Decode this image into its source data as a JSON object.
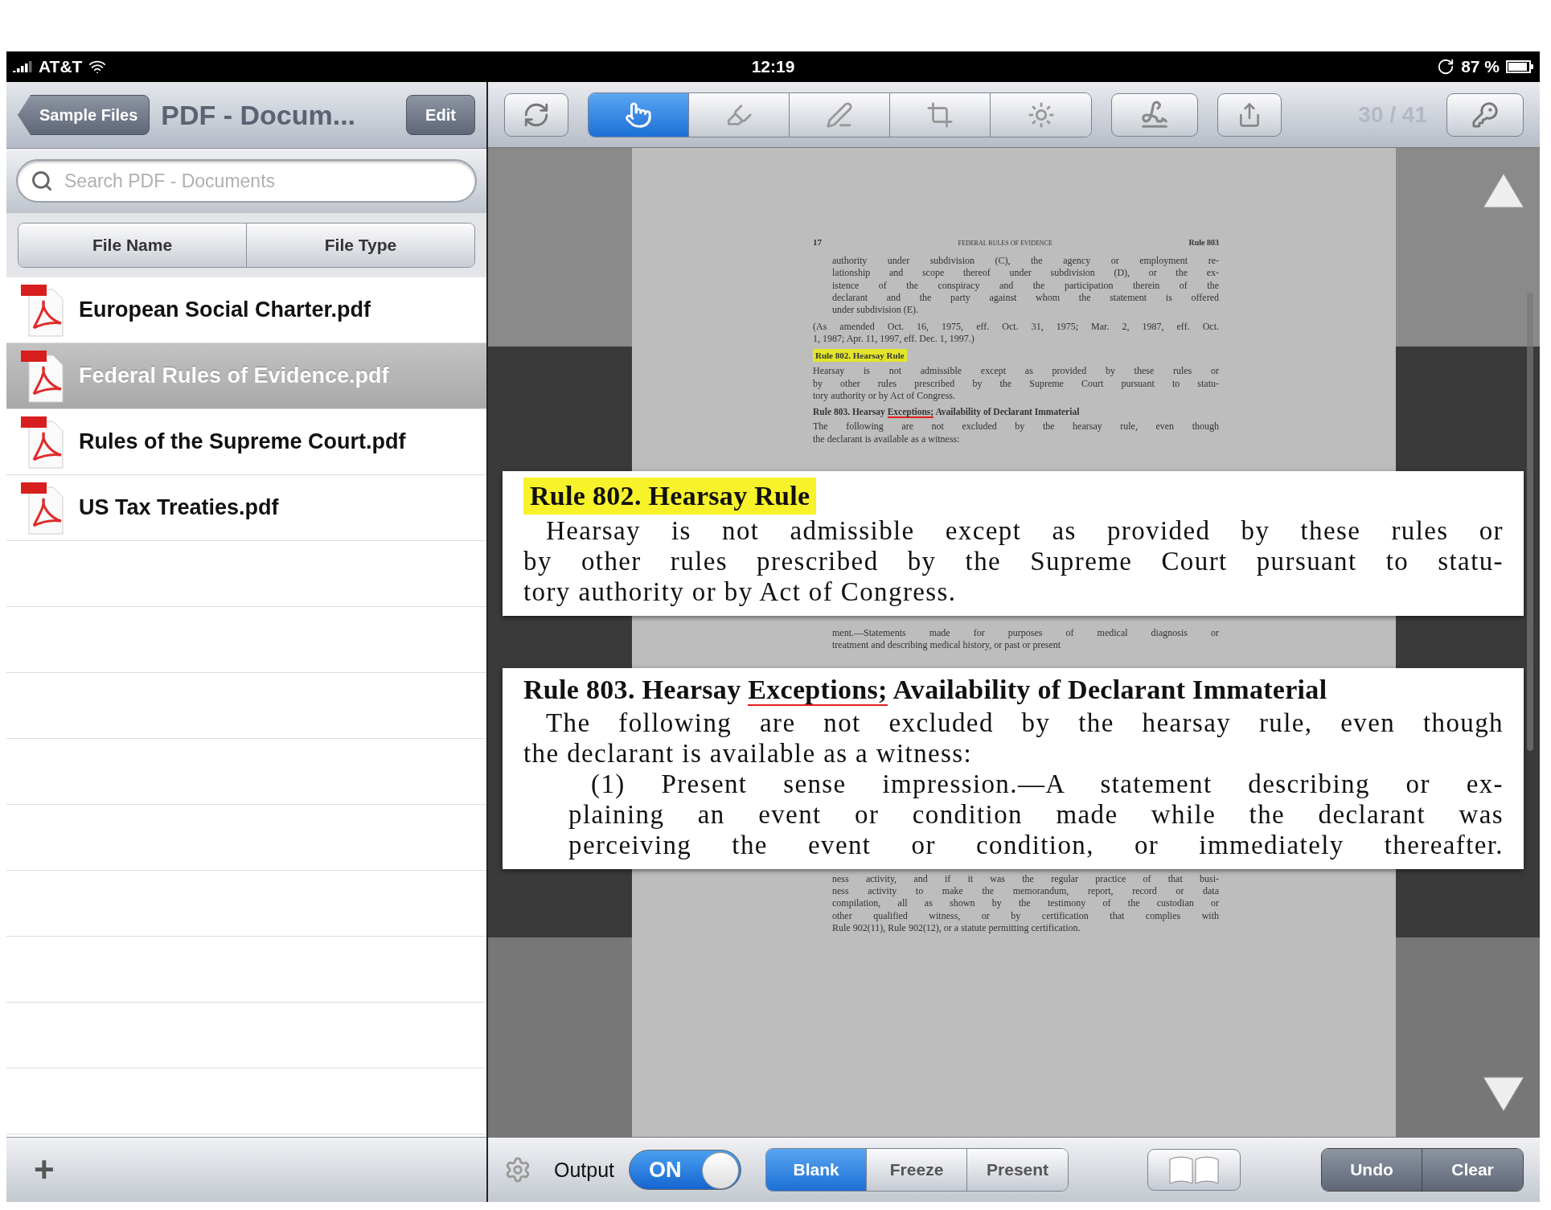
{
  "status_bar": {
    "carrier": "AT&T",
    "time": "12:19",
    "battery": "87 %"
  },
  "sidebar": {
    "back_button": "Sample Files",
    "title": "PDF - Docum...",
    "edit_button": "Edit",
    "search": {
      "placeholder": "Search PDF - Documents"
    },
    "sort_tabs": [
      {
        "label": "File Name"
      },
      {
        "label": "File Type"
      }
    ],
    "files": [
      {
        "name": "European Social Charter.pdf",
        "selected": false
      },
      {
        "name": "Federal Rules of Evidence.pdf",
        "selected": true
      },
      {
        "name": "Rules of the Supreme Court.pdf",
        "selected": false
      },
      {
        "name": "US Tax Treaties.pdf",
        "selected": false
      }
    ],
    "add_button": "+"
  },
  "toolbar": {
    "tools": [
      {
        "kind": "pointer",
        "selected": true
      },
      {
        "kind": "highlighter",
        "selected": false
      },
      {
        "kind": "pen",
        "selected": false
      },
      {
        "kind": "crop",
        "selected": false
      },
      {
        "kind": "spotlight",
        "selected": false
      }
    ],
    "page_indicator": "30 / 41"
  },
  "document": {
    "page": {
      "page_number": "17",
      "running_head": "FEDERAL RULES OF EVIDENCE",
      "rule_ref": "Rule 803",
      "top_blocks": [
        {
          "kind": "indented",
          "lines": [
            "authority under subdivision (C), the agency or employment re-",
            "lationship and scope thereof under subdivision (D), or the ex-",
            "istence of the conspiracy and the participation therein of the",
            "declarant and the party against whom the statement is offered",
            "under subdivision (E)."
          ]
        },
        {
          "kind": "plain",
          "lines": [
            "(As amended Oct. 16, 1975, eff. Oct. 31, 1975; Mar. 2, 1987, eff. Oct.",
            "1, 1987; Apr. 11, 1997, eff. Dec. 1, 1997.)"
          ]
        },
        {
          "kind": "highlighted_heading",
          "lines": [
            "Rule 802. Hearsay Rule"
          ]
        },
        {
          "kind": "plain",
          "lines": [
            "Hearsay is not admissible except as provided by these rules or",
            "by other rules prescribed by the Supreme Court pursuant to statu-",
            "tory authority or by Act of Congress."
          ]
        },
        {
          "kind": "heading",
          "parts": [
            {
              "text": "Rule 803. Hearsay ",
              "underlined": false
            },
            {
              "text": "Exceptions;",
              "underlined": true
            },
            {
              "text": " Availability of Declarant Immaterial",
              "underlined": false
            }
          ]
        },
        {
          "kind": "plain",
          "lines": [
            "The following are not excluded by the hearsay rule, even though",
            "the declarant is available as a witness:"
          ]
        }
      ],
      "middle_lines": [
        "ment.—Statements made for purposes of medical diagnosis or",
        "treatment and describing medical history, or past or present"
      ],
      "bottom_lines": [
        "ness activity, and if it was the regular practice of that busi-",
        "ness activity to make the memorandum, report, record or data",
        "compilation, all as shown by the testimony of the custodian or",
        "other qualified witness, or by certification that complies with",
        "Rule 902(11), Rule 902(12), or a statute permitting certification."
      ]
    },
    "magnifier": [
      {
        "heading_parts": [
          {
            "text": "Rule 802. Hearsay Rule",
            "underlined": false
          }
        ],
        "heading_highlighted": true,
        "paragraphs": [
          {
            "kind": "body",
            "lines": [
              "Hearsay is not admissible except as provided by these rules or",
              "by other rules prescribed by the Supreme Court pursuant to statu-",
              "tory authority or by Act of Congress."
            ]
          }
        ]
      },
      {
        "heading_parts": [
          {
            "text": "Rule 803. Hearsay ",
            "underlined": false
          },
          {
            "text": "Exceptions;",
            "underlined": true
          },
          {
            "text": " Availability of Declarant Immaterial",
            "underlined": false
          }
        ],
        "heading_highlighted": false,
        "paragraphs": [
          {
            "kind": "body",
            "lines": [
              "The following are not excluded by the hearsay rule, even though",
              "the declarant is available as a witness:"
            ]
          },
          {
            "kind": "item",
            "lines": [
              "(1) Present sense impression.—A statement describing or ex-",
              "plaining an event or condition made while the declarant was",
              "perceiving the event or condition, or immediately thereafter."
            ]
          }
        ]
      }
    ]
  },
  "bottom_bar": {
    "output_label": "Output",
    "output_toggle": {
      "label": "ON",
      "on": true
    },
    "modes": [
      {
        "label": "Blank",
        "selected": true
      },
      {
        "label": "Freeze",
        "selected": false
      },
      {
        "label": "Present",
        "selected": false
      }
    ],
    "actions": [
      {
        "label": "Undo"
      },
      {
        "label": "Clear"
      }
    ]
  }
}
